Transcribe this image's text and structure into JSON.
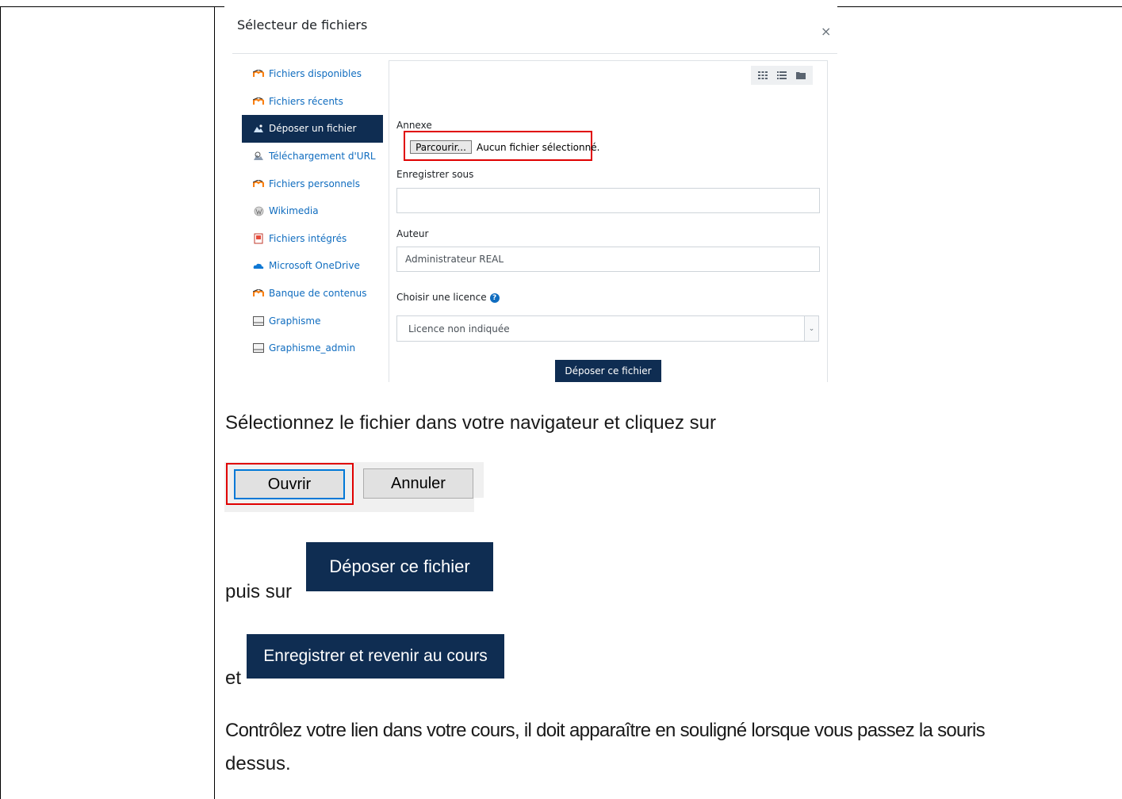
{
  "dialog": {
    "title": "Sélecteur de fichiers",
    "close_symbol": "×",
    "sidebar": [
      {
        "label": "Fichiers disponibles",
        "icon": "moodle-icon"
      },
      {
        "label": "Fichiers récents",
        "icon": "moodle-icon"
      },
      {
        "label": "Déposer un fichier",
        "icon": "upload-icon",
        "active": true
      },
      {
        "label": "Téléchargement d'URL",
        "icon": "url-download-icon"
      },
      {
        "label": "Fichiers personnels",
        "icon": "moodle-icon"
      },
      {
        "label": "Wikimedia",
        "icon": "wikimedia-icon"
      },
      {
        "label": "Fichiers intégrés",
        "icon": "embedded-files-icon"
      },
      {
        "label": "Microsoft OneDrive",
        "icon": "onedrive-icon"
      },
      {
        "label": "Banque de contenus",
        "icon": "moodle-icon"
      },
      {
        "label": "Graphisme",
        "icon": "repository-icon"
      },
      {
        "label": "Graphisme_admin",
        "icon": "repository-icon"
      }
    ],
    "form": {
      "attachment_label": "Annexe",
      "browse_label": "Parcourir...",
      "no_file_text": "Aucun fichier sélectionné.",
      "save_as_label": "Enregistrer sous",
      "save_as_value": "",
      "author_label": "Auteur",
      "author_value": "Administrateur REAL",
      "license_label": "Choisir une licence",
      "license_value": "Licence non indiquée",
      "upload_button": "Déposer ce fichier"
    }
  },
  "instructions": {
    "line1": "Sélectionnez le fichier dans votre navigateur et cliquez sur",
    "open_button": "Ouvrir",
    "cancel_button": "Annuler",
    "then_on": "puis sur",
    "upload_button": "Déposer ce fichier",
    "and": "et",
    "save_return_button": "Enregistrer et revenir au cours",
    "check_line1": "Contrôlez votre lien dans votre cours, il doit apparaître en souligné lorsque vous passez la souris",
    "check_line2": "dessus."
  },
  "colors": {
    "accent_dark": "#0f2d52",
    "link": "#0f6cbf",
    "highlight_red": "#e00000"
  }
}
